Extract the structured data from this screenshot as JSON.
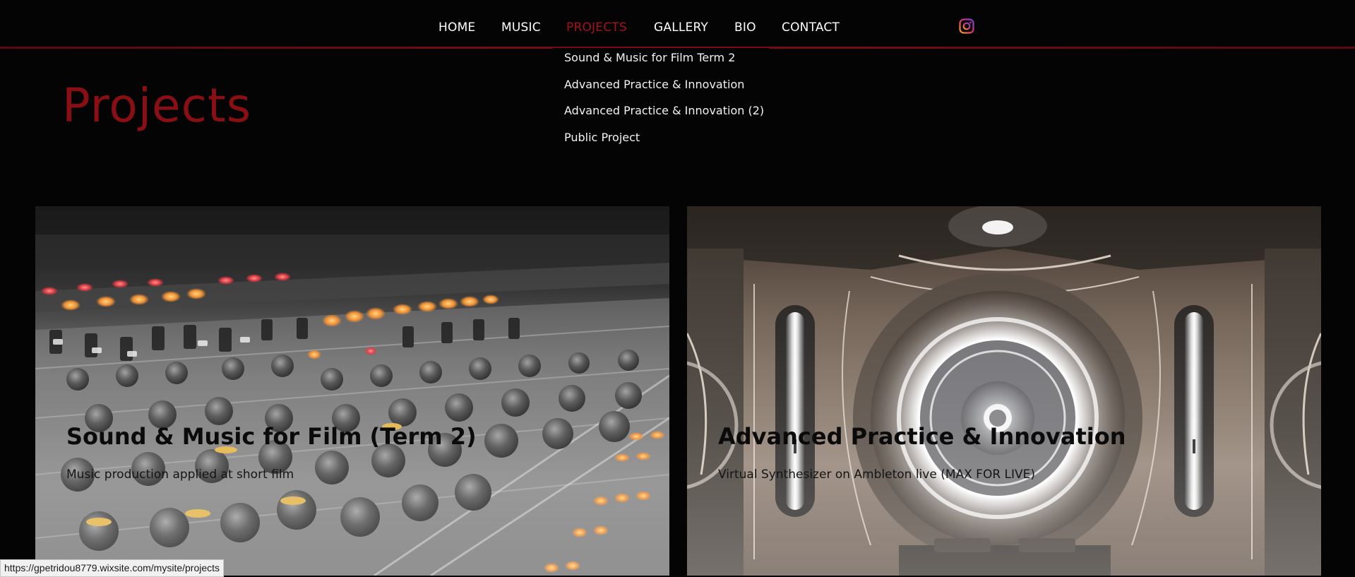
{
  "nav": {
    "items": [
      {
        "label": "HOME"
      },
      {
        "label": "MUSIC"
      },
      {
        "label": "PROJECTS",
        "active": true
      },
      {
        "label": "GALLERY"
      },
      {
        "label": "BIO"
      },
      {
        "label": "CONTACT"
      }
    ],
    "social_icon": "instagram-icon"
  },
  "dropdown": {
    "items": [
      {
        "label": "Sound & Music for Film Term 2"
      },
      {
        "label": "Advanced Practice & Innovation"
      },
      {
        "label": "Advanced Practice & Innovation (2)"
      },
      {
        "label": "Public Project"
      }
    ]
  },
  "page": {
    "title": "Projects"
  },
  "cards": [
    {
      "title": "Sound & Music for Film (Term 2)",
      "subtitle": "Music production applied at short film",
      "image": "mixing-console-image"
    },
    {
      "title": "Advanced Practice & Innovation",
      "subtitle": "Virtual Synthesizer on Ambleton live (MAX FOR LIVE)",
      "image": "futuristic-speaker-image"
    }
  ],
  "status_bar": {
    "url": "https://gpetridou8779.wixsite.com/mysite/projects"
  },
  "colors": {
    "background": "#050405",
    "accent_red": "#a3121a",
    "title_red": "#8a0f15",
    "nav_text": "#ffffff"
  }
}
